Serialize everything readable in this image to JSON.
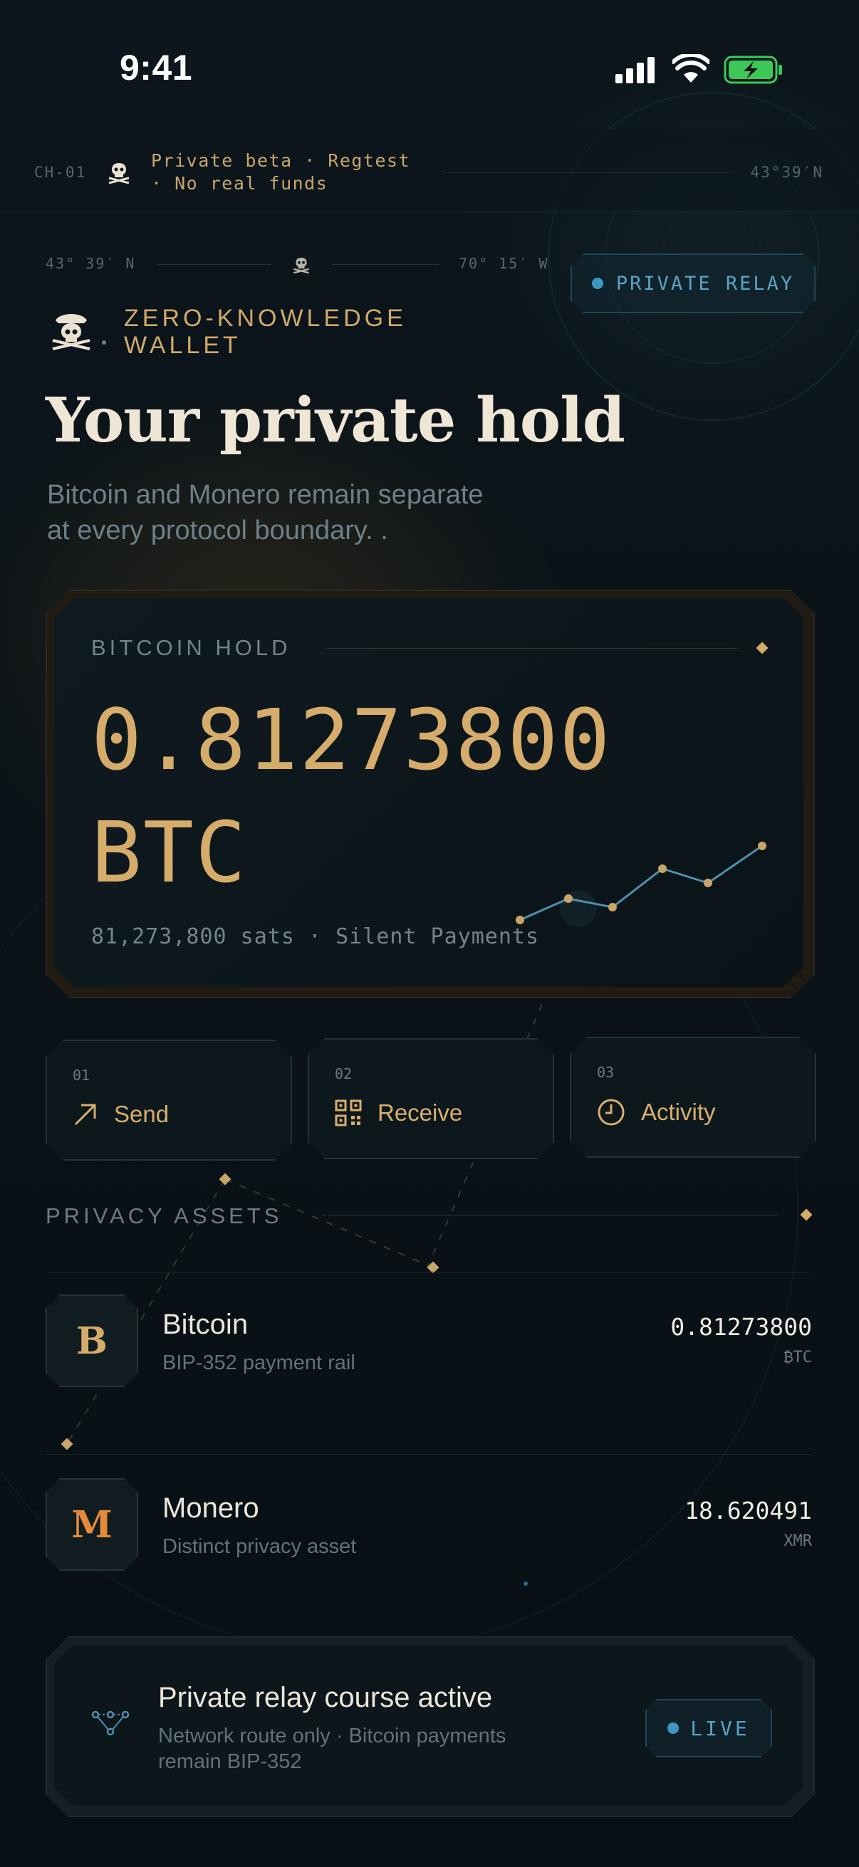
{
  "status_bar": {
    "time": "9:41"
  },
  "beta_bar": {
    "channel": "CH-01",
    "notice_line1": "Private beta · Regtest",
    "notice_line2": "· No real funds",
    "coordinate": "43°39′N"
  },
  "coords": {
    "lat": "43° 39′ N",
    "lon": "70° 15′ W"
  },
  "relay_badge": {
    "label": "PRIVATE RELAY"
  },
  "brand": {
    "line1": "ZERO-KNOWLEDGE",
    "line2": "WALLET"
  },
  "hero": {
    "title": "Your private hold",
    "subtitle_line1": "Bitcoin and Monero remain separate",
    "subtitle_line2": "at every protocol boundary.  ."
  },
  "bitcoin_card": {
    "label": "BITCOIN HOLD",
    "amount": "0.81273800",
    "unit": "BTC",
    "sats_line": "81,273,800 sats · Silent Payments"
  },
  "actions": [
    {
      "num": "01",
      "label": "Send"
    },
    {
      "num": "02",
      "label": "Receive"
    },
    {
      "num": "03",
      "label": "Activity"
    }
  ],
  "privacy_assets": {
    "label": "PRIVACY ASSETS",
    "items": [
      {
        "symbol": "B",
        "name": "Bitcoin",
        "desc": "BIP-352 payment rail",
        "amount": "0.81273800",
        "unit": "₿TC",
        "color": "#d6ac6b"
      },
      {
        "symbol": "M",
        "name": "Monero",
        "desc": "Distinct privacy asset",
        "amount": "18.620491",
        "unit": "XMR",
        "color": "#e58a3a"
      }
    ]
  },
  "relay_card": {
    "title": "Private relay course active",
    "desc_line1": "Network route only · Bitcoin payments",
    "desc_line2": "remain BIP-352",
    "badge": "LIVE"
  },
  "colors": {
    "gold": "#d6ac6b",
    "teal": "#5aa3c4",
    "background": "#0a1217",
    "monero": "#e58a3a"
  },
  "icons": [
    "pirate-skull-icon",
    "send-arrow-icon",
    "qr-code-icon",
    "clock-icon",
    "network-route-icon",
    "wifi-icon",
    "signal-icon",
    "battery-charging-icon"
  ]
}
